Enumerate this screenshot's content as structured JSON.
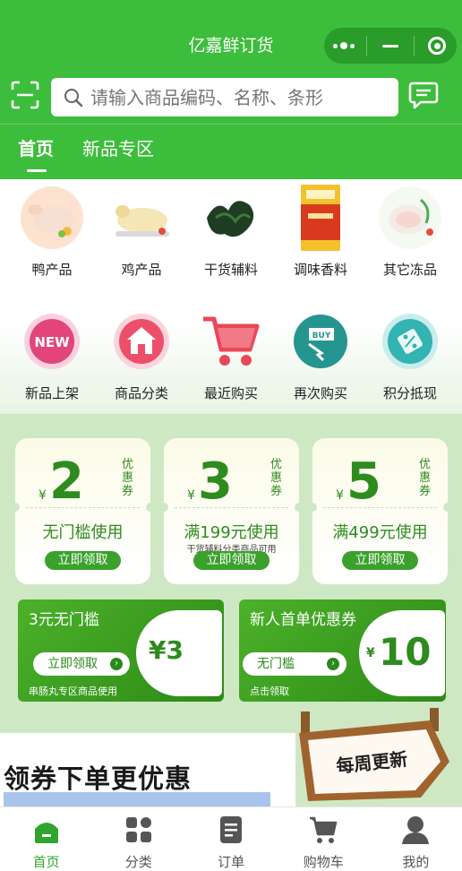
{
  "app": {
    "title": "亿嘉鲜订货"
  },
  "search": {
    "placeholder": "请输入商品编码、名称、条形"
  },
  "tabs": [
    {
      "label": "首页",
      "active": true
    },
    {
      "label": "新品专区",
      "active": false
    }
  ],
  "categories": [
    {
      "label": "鸭产品",
      "icon": "duck-product-icon"
    },
    {
      "label": "鸡产品",
      "icon": "chicken-product-icon"
    },
    {
      "label": "干货辅料",
      "icon": "dried-goods-icon"
    },
    {
      "label": "调味香料",
      "icon": "seasoning-icon"
    },
    {
      "label": "其它冻品",
      "icon": "frozen-goods-icon"
    }
  ],
  "shortcuts": [
    {
      "label": "新品上架",
      "icon": "new-icon",
      "badge": "NEW"
    },
    {
      "label": "商品分类",
      "icon": "home-category-icon"
    },
    {
      "label": "最近购买",
      "icon": "cart-icon"
    },
    {
      "label": "再次购买",
      "icon": "buy-again-icon",
      "badge": "BUY"
    },
    {
      "label": "积分抵现",
      "icon": "points-icon"
    }
  ],
  "coupons": [
    {
      "amount": "2",
      "currency": "¥",
      "tag": "优惠券",
      "condition": "无门槛使用",
      "note": "",
      "button": "立即领取"
    },
    {
      "amount": "3",
      "currency": "¥",
      "tag": "优惠券",
      "condition": "满199元使用",
      "note": "干货辅料分类商品可用",
      "button": "立即领取"
    },
    {
      "amount": "5",
      "currency": "¥",
      "tag": "优惠券",
      "condition": "满499元使用",
      "note": "",
      "button": "立即领取"
    }
  ],
  "banners": [
    {
      "title": "3元无门槛",
      "button": "立即领取",
      "note": "串肠丸专区商品使用",
      "value": "¥3"
    },
    {
      "title": "新人首单优惠券",
      "button": "无门槛",
      "note": "点击领取",
      "currency": "¥",
      "value": "10"
    }
  ],
  "promo": {
    "sign": "每周更新",
    "slogan": "领券下单更优惠"
  },
  "nav": [
    {
      "label": "首页",
      "icon": "home-icon",
      "active": true
    },
    {
      "label": "分类",
      "icon": "category-icon",
      "active": false
    },
    {
      "label": "订单",
      "icon": "order-icon",
      "active": false
    },
    {
      "label": "购物车",
      "icon": "shopping-cart-icon",
      "active": false
    },
    {
      "label": "我的",
      "icon": "profile-icon",
      "active": false
    }
  ],
  "colors": {
    "brand": "#3dbd3c",
    "coupon_green": "#2e8b1e",
    "promo_bg": "#cfe8c4"
  }
}
